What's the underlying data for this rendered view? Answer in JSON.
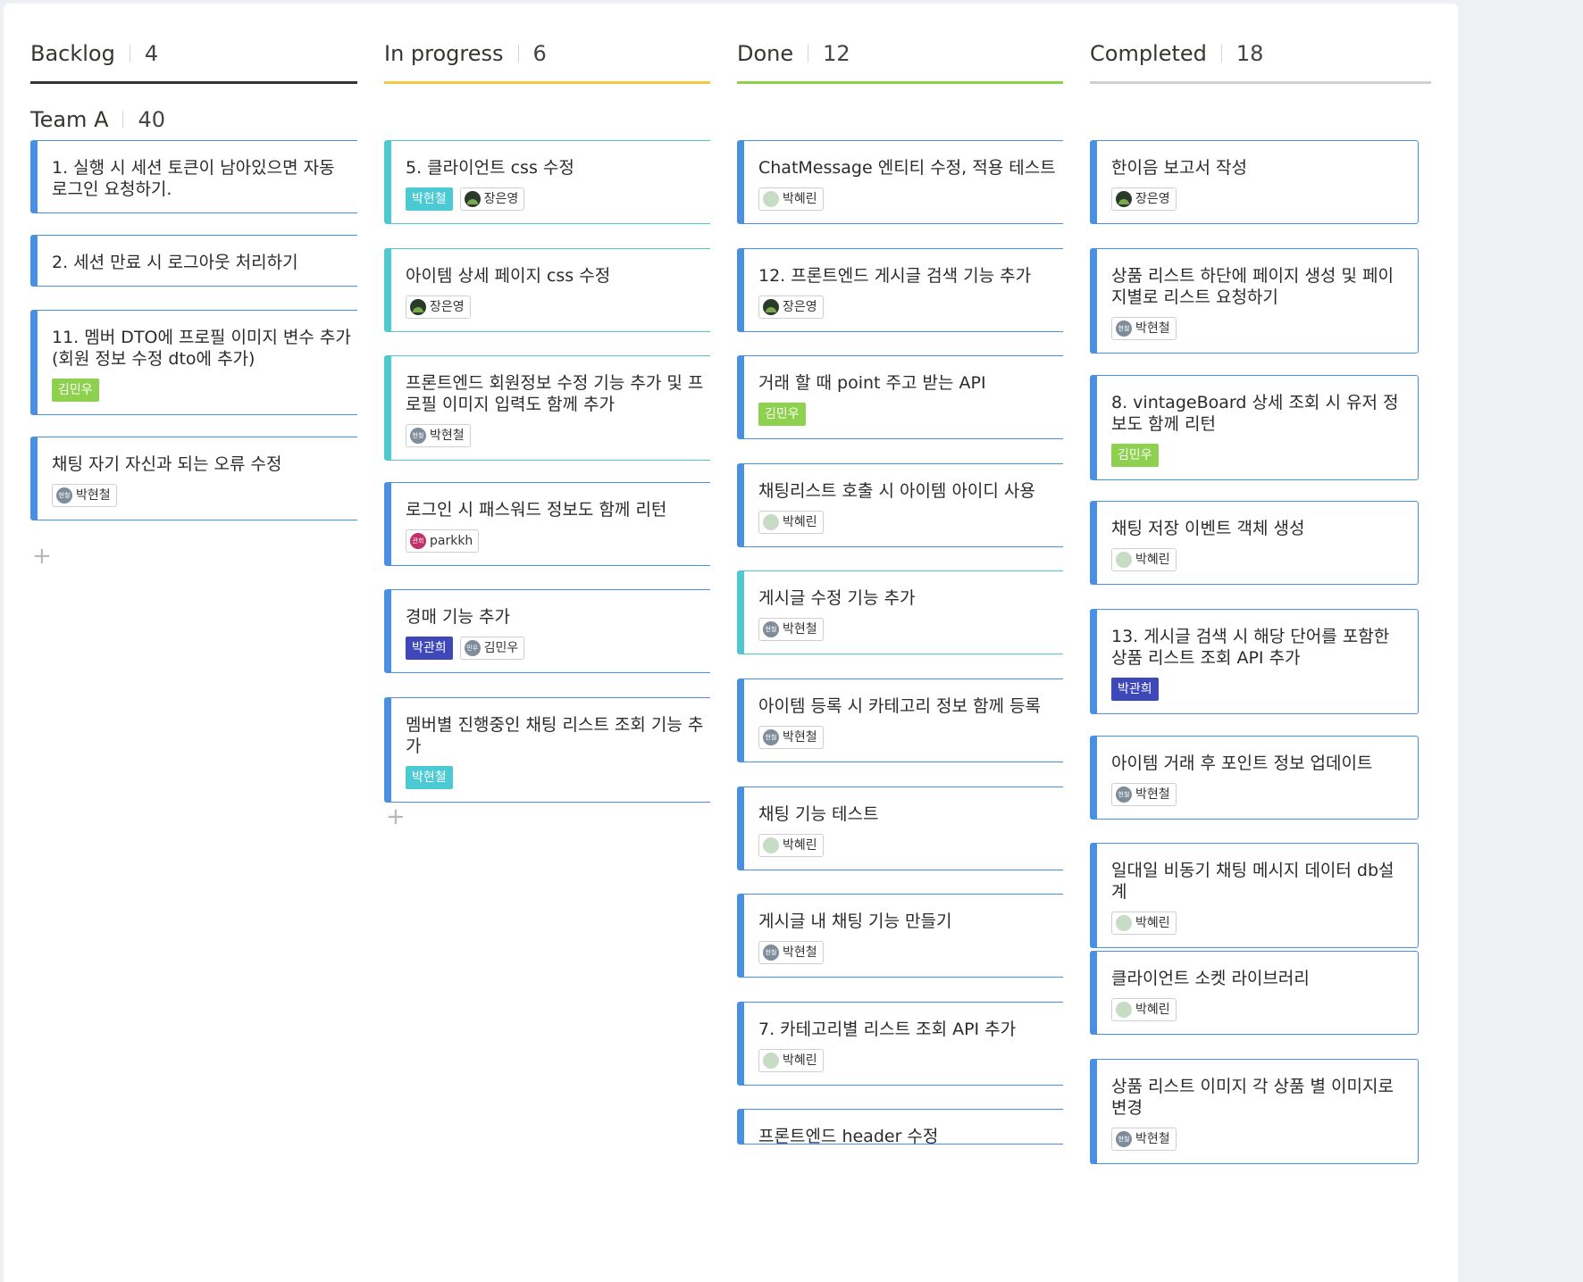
{
  "colors": {
    "backlog_underline": "#333333",
    "inprogress_underline": "#f5c842",
    "done_underline": "#8dd14f",
    "completed_underline": "#cfcfcf",
    "card_blue": "#4a90e2",
    "card_teal": "#4fc8d0",
    "tag_teal": "#4ccad4",
    "tag_green": "#8dd14f",
    "tag_indigo": "#3f48b8"
  },
  "group": {
    "name": "Team A",
    "count": "40"
  },
  "add_icon": "+",
  "columns": [
    {
      "name": "Backlog",
      "count": "4",
      "cards": [
        {
          "title": "1. 실행 시 세션 토큰이 남아있으면 자동 로그인 요청하기.",
          "color": "blue",
          "tags": []
        },
        {
          "title": "2. 세션 만료 시 로그아웃 처리하기",
          "color": "blue",
          "tags": []
        },
        {
          "title": "11. 멤버 DTO에 프로필 이미지 변수 추가(회원 정보 수정 dto에 추가)",
          "color": "blue",
          "tags": [
            {
              "type": "solid",
              "label": "김민우",
              "color": "green"
            }
          ]
        },
        {
          "title": "채팅 자기 자신과 되는 오류 수정",
          "color": "blue",
          "tags": [
            {
              "type": "user",
              "label": "박현철",
              "avatar": "gray",
              "avatar_text": "현철"
            }
          ]
        }
      ]
    },
    {
      "name": "In progress",
      "count": "6",
      "cards": [
        {
          "title": "5. 클라이언트 css 수정",
          "color": "teal",
          "tags": [
            {
              "type": "solid",
              "label": "박현철",
              "color": "teal"
            },
            {
              "type": "user",
              "label": "장은영",
              "avatar": "dark",
              "avatar_text": ""
            }
          ]
        },
        {
          "title": "아이템 상세 페이지 css 수정",
          "color": "teal",
          "tags": [
            {
              "type": "user",
              "label": "장은영",
              "avatar": "dark",
              "avatar_text": ""
            }
          ]
        },
        {
          "title": "프론트엔드 회원정보 수정 기능 추가 및 프로필 이미지 입력도 함께 추가",
          "color": "teal",
          "tags": [
            {
              "type": "user",
              "label": "박현철",
              "avatar": "gray",
              "avatar_text": "현철"
            }
          ]
        },
        {
          "title": "로그인 시 패스워드 정보도 함께 리턴",
          "color": "blue",
          "tags": [
            {
              "type": "user",
              "label": "parkkh",
              "avatar": "red",
              "avatar_text": "관희"
            }
          ]
        },
        {
          "title": "경매 기능 추가",
          "color": "blue",
          "tags": [
            {
              "type": "solid",
              "label": "박관희",
              "color": "indigo"
            },
            {
              "type": "user",
              "label": "김민우",
              "avatar": "gray",
              "avatar_text": "민우"
            }
          ]
        },
        {
          "title": "멤버별 진행중인 채팅 리스트 조회 기능 추가",
          "color": "blue",
          "tags": [
            {
              "type": "solid",
              "label": "박현철",
              "color": "teal"
            }
          ]
        }
      ]
    },
    {
      "name": "Done",
      "count": "12",
      "cards": [
        {
          "title": "ChatMessage 엔티티 수정, 적용 테스트",
          "color": "blue",
          "tags": [
            {
              "type": "user",
              "label": "박혜린",
              "avatar": "green",
              "avatar_text": ""
            }
          ]
        },
        {
          "title": "12. 프론트엔드 게시글 검색 기능 추가",
          "color": "blue",
          "tags": [
            {
              "type": "user",
              "label": "장은영",
              "avatar": "dark",
              "avatar_text": ""
            }
          ]
        },
        {
          "title": "거래 할 때 point 주고 받는 API",
          "color": "blue",
          "tags": [
            {
              "type": "solid",
              "label": "김민우",
              "color": "green"
            }
          ]
        },
        {
          "title": "채팅리스트 호출 시 아이템 아이디 사용",
          "color": "blue",
          "tags": [
            {
              "type": "user",
              "label": "박혜린",
              "avatar": "green",
              "avatar_text": ""
            }
          ]
        },
        {
          "title": "게시글 수정 기능 추가",
          "color": "teal",
          "tags": [
            {
              "type": "user",
              "label": "박현철",
              "avatar": "gray",
              "avatar_text": "현철"
            }
          ]
        },
        {
          "title": "아이템 등록 시 카테고리 정보 함께 등록",
          "color": "blue",
          "tags": [
            {
              "type": "user",
              "label": "박현철",
              "avatar": "gray",
              "avatar_text": "현철"
            }
          ]
        },
        {
          "title": "채팅 기능 테스트",
          "color": "blue",
          "tags": [
            {
              "type": "user",
              "label": "박혜린",
              "avatar": "green",
              "avatar_text": ""
            }
          ]
        },
        {
          "title": "게시글 내 채팅 기능 만들기",
          "color": "blue",
          "tags": [
            {
              "type": "user",
              "label": "박현철",
              "avatar": "gray",
              "avatar_text": "현철"
            }
          ]
        },
        {
          "title": "7. 카테고리별 리스트 조회 API 추가",
          "color": "blue",
          "tags": [
            {
              "type": "user",
              "label": "박혜린",
              "avatar": "green",
              "avatar_text": ""
            }
          ]
        },
        {
          "title": "프론트엔드 header 수정",
          "color": "blue",
          "tags": []
        }
      ]
    },
    {
      "name": "Completed",
      "count": "18",
      "cards": [
        {
          "title": "한이음 보고서 작성",
          "color": "blue",
          "tags": [
            {
              "type": "user",
              "label": "장은영",
              "avatar": "dark",
              "avatar_text": ""
            }
          ]
        },
        {
          "title": "상품 리스트 하단에 페이지 생성 및 페이지별로 리스트 요청하기",
          "color": "blue",
          "tags": [
            {
              "type": "user",
              "label": "박현철",
              "avatar": "gray",
              "avatar_text": "현철"
            }
          ]
        },
        {
          "title": "8. vintageBoard 상세 조회 시 유저 정보도 함께 리턴",
          "color": "blue",
          "tags": [
            {
              "type": "solid",
              "label": "김민우",
              "color": "green"
            }
          ]
        },
        {
          "title": "채팅 저장 이벤트 객체 생성",
          "color": "blue",
          "tags": [
            {
              "type": "user",
              "label": "박혜린",
              "avatar": "green",
              "avatar_text": ""
            }
          ]
        },
        {
          "title": "13. 게시글 검색 시 해당 단어를 포함한 상품 리스트 조회 API 추가",
          "color": "blue",
          "tags": [
            {
              "type": "solid",
              "label": "박관희",
              "color": "indigo"
            }
          ]
        },
        {
          "title": "아이템 거래 후 포인트 정보 업데이트",
          "color": "blue",
          "tags": [
            {
              "type": "user",
              "label": "박현철",
              "avatar": "gray",
              "avatar_text": "현철"
            }
          ]
        },
        {
          "title": "일대일 비동기 채팅 메시지 데이터 db설계",
          "color": "blue",
          "tags": [
            {
              "type": "user",
              "label": "박혜린",
              "avatar": "green",
              "avatar_text": ""
            }
          ]
        },
        {
          "title": "클라이언트 소켓  라이브러리",
          "color": "blue",
          "tags": [
            {
              "type": "user",
              "label": "박혜린",
              "avatar": "green",
              "avatar_text": ""
            }
          ]
        },
        {
          "title": "상품 리스트 이미지 각 상품 별 이미지로 변경",
          "color": "blue",
          "tags": [
            {
              "type": "user",
              "label": "박현철",
              "avatar": "gray",
              "avatar_text": "현철"
            }
          ]
        }
      ]
    }
  ]
}
